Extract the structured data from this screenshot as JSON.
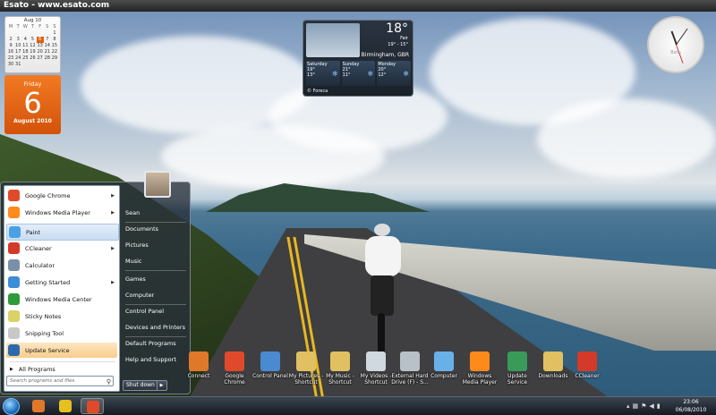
{
  "window": {
    "title": "Esato - www.esato.com"
  },
  "calendar": {
    "month_label": "Aug 10",
    "weekdays": [
      "M",
      "T",
      "W",
      "T",
      "F",
      "S",
      "S"
    ],
    "days": [
      "",
      "",
      "",
      "",
      "",
      "",
      "1",
      "2",
      "3",
      "4",
      "5",
      "6",
      "7",
      "8",
      "9",
      "10",
      "11",
      "12",
      "13",
      "14",
      "15",
      "16",
      "17",
      "18",
      "19",
      "20",
      "21",
      "22",
      "23",
      "24",
      "25",
      "26",
      "27",
      "28",
      "29",
      "30",
      "31",
      "",
      "",
      "",
      "",
      ""
    ],
    "today": "6",
    "day_name": "Friday",
    "day_number": "6",
    "month_year": "August 2010"
  },
  "weather": {
    "temp": "18°",
    "condition": "Fair",
    "range": "19° - 15°",
    "city": "Birmingham, GBR",
    "forecast": [
      {
        "day": "Saturday",
        "high": "19°",
        "low": "13°"
      },
      {
        "day": "Sunday",
        "high": "21°",
        "low": "11°"
      },
      {
        "day": "Monday",
        "high": "20°",
        "low": "12°"
      }
    ],
    "source": "© Foreca"
  },
  "clock": {
    "label": "Bath"
  },
  "start_menu": {
    "left_items": [
      {
        "label": "Google Chrome",
        "icon": "chrome-icon",
        "has_arrow": true,
        "color": "#e04a2a"
      },
      {
        "label": "Windows Media Player",
        "icon": "media-player-icon",
        "has_arrow": true,
        "color": "#ff8a1c"
      },
      {
        "label": "Paint",
        "icon": "paint-icon",
        "has_arrow": false,
        "color": "#4aa0e6"
      },
      {
        "label": "CCleaner",
        "icon": "ccleaner-icon",
        "has_arrow": true,
        "color": "#d43a2a"
      },
      {
        "label": "Calculator",
        "icon": "calculator-icon",
        "has_arrow": false,
        "color": "#7a8fa8"
      },
      {
        "label": "Getting Started",
        "icon": "getting-started-icon",
        "has_arrow": true,
        "color": "#3c8ed8"
      },
      {
        "label": "Windows Media Center",
        "icon": "media-center-icon",
        "has_arrow": false,
        "color": "#2f9a3a"
      },
      {
        "label": "Sticky Notes",
        "icon": "sticky-notes-icon",
        "has_arrow": false,
        "color": "#d9d266"
      },
      {
        "label": "Snipping Tool",
        "icon": "snipping-tool-icon",
        "has_arrow": false,
        "color": "#c8c8c8"
      },
      {
        "label": "Update Service",
        "icon": "update-service-icon",
        "has_arrow": false,
        "color": "#2c6ab0"
      }
    ],
    "all_programs": "All Programs",
    "search_placeholder": "Search programs and files",
    "right_items": [
      "Sean",
      "Documents",
      "Pictures",
      "Music",
      "Games",
      "Computer",
      "Control Panel",
      "Devices and Printers",
      "Default Programs",
      "Help and Support"
    ],
    "shutdown_label": "Shut down"
  },
  "desktop_icons": [
    {
      "label": "Connect",
      "icon": "connect-icon",
      "color": "#e0782a"
    },
    {
      "label": "Google Chrome",
      "icon": "chrome-icon",
      "color": "#e04a2a"
    },
    {
      "label": "Control Panel",
      "icon": "control-panel-icon",
      "color": "#4a8ad0"
    },
    {
      "label": "My Pictures - Shortcut",
      "icon": "folder-icon",
      "color": "#e0c060"
    },
    {
      "label": "My Music - Shortcut",
      "icon": "folder-music-icon",
      "color": "#e0c060"
    },
    {
      "label": "My Videos - Shortcut",
      "icon": "dvd-icon",
      "color": "#d0d8e0"
    },
    {
      "label": "External Hard Drive (F) - S...",
      "icon": "hard-drive-icon",
      "color": "#b8c0c8"
    },
    {
      "label": "Computer",
      "icon": "computer-icon",
      "color": "#6ab0e8"
    },
    {
      "label": "Windows Media Player",
      "icon": "media-player-icon",
      "color": "#ff8a1c"
    },
    {
      "label": "Update Service",
      "icon": "update-service-icon",
      "color": "#3a9a5a"
    },
    {
      "label": "Downloads",
      "icon": "downloads-folder-icon",
      "color": "#e0c060"
    },
    {
      "label": "CCleaner",
      "icon": "ccleaner-icon",
      "color": "#d43a2a"
    }
  ],
  "taskbar": {
    "pinned": [
      {
        "icon": "connect-icon",
        "color": "#e0782a",
        "active": false
      },
      {
        "icon": "windows-live-icon",
        "color": "#e6c020",
        "active": false
      },
      {
        "icon": "chrome-icon",
        "color": "#e04a2a",
        "active": true
      }
    ],
    "time": "23:06",
    "date": "06/08/2010"
  }
}
